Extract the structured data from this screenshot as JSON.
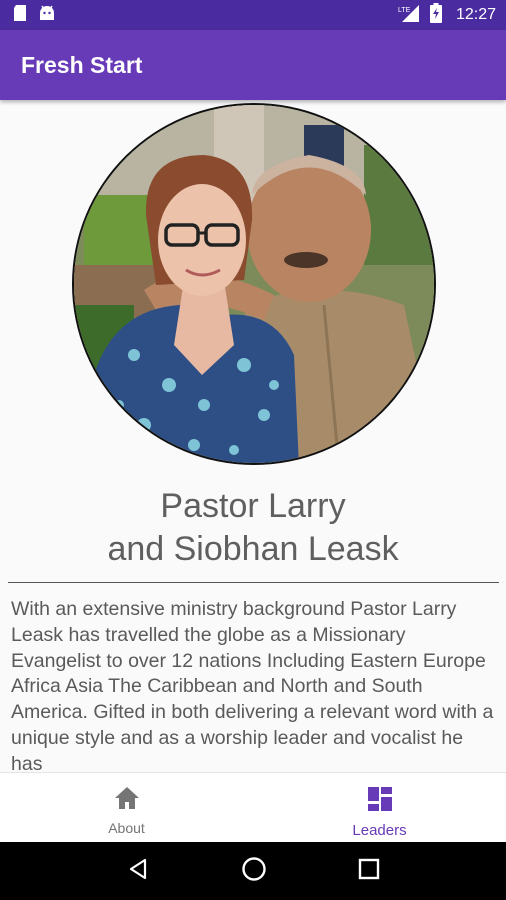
{
  "status_bar": {
    "time": "12:27",
    "network": "LTE",
    "icons": [
      "sd-card-icon",
      "android-icon",
      "signal-icon",
      "battery-icon"
    ]
  },
  "app_bar": {
    "title": "Fresh Start"
  },
  "leader": {
    "name_line1": "Pastor Larry",
    "name_line2": "and Siobhan Leask",
    "bio": "With an extensive ministry background Pastor Larry Leask has travelled the globe as a Missionary Evangelist to over 12 nations Including Eastern Europe Africa Asia The Caribbean and North and South America. Gifted in both delivering a relevant word with a unique style and as a worship leader and vocalist he has"
  },
  "bottom_nav": {
    "items": [
      {
        "label": "About",
        "icon": "home-icon",
        "active": false
      },
      {
        "label": "Leaders",
        "icon": "dashboard-icon",
        "active": true
      }
    ]
  },
  "colors": {
    "status_bar": "#4b2ca0",
    "app_bar": "#673ab7",
    "active_tab": "#673ab7",
    "inactive_tab": "#757575"
  }
}
